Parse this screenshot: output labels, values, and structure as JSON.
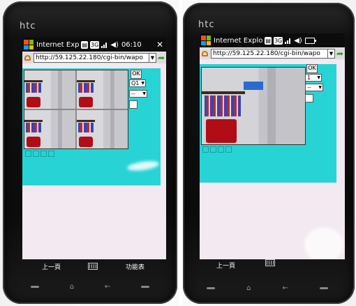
{
  "left_phone": {
    "brand": "htc",
    "status": {
      "app_title": "Internet Exp",
      "icon1": "🖭",
      "net": "3G",
      "clock": "06:10",
      "close": "✕"
    },
    "address": {
      "url": "http://59.125.22.180/cgi-bin/wapo"
    },
    "controls": {
      "ok_label": "OK",
      "camera_select": "Q1",
      "second_select": "--"
    },
    "softbar": {
      "left": "上一頁",
      "right": "功能表"
    }
  },
  "right_phone": {
    "brand": "htc",
    "status": {
      "app_title": "Internet Explo",
      "icon1": "🖭",
      "net": "3G"
    },
    "address": {
      "url": "http://59.125.22.180/cgi-bin/wapo"
    },
    "controls": {
      "ok_label": "OK",
      "camera_select": "1",
      "second_select": "--"
    },
    "softbar": {
      "left": "上一頁"
    }
  },
  "colors": {
    "page_accent": "#28d3d6",
    "page_bg": "#f3e9f0",
    "go_arrow": "#2a9a1f"
  },
  "icons": [
    "windows-logo-icon",
    "signal-icon",
    "volume-icon",
    "battery-icon",
    "close-icon",
    "page-icon",
    "dropdown-arrow-icon",
    "go-arrow-icon",
    "keyboard-icon",
    "home-icon",
    "back-icon",
    "end-call-icon"
  ]
}
